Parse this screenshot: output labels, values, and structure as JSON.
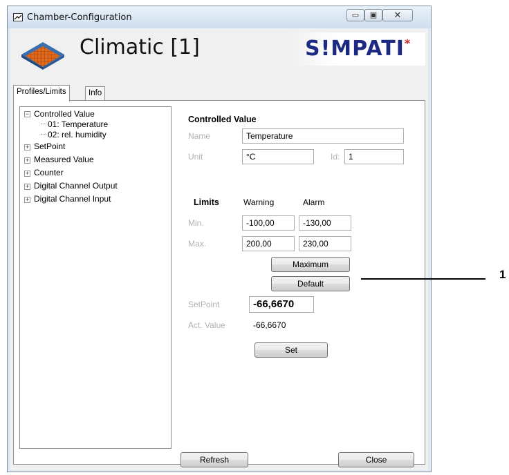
{
  "window": {
    "title": "Chamber-Configuration",
    "controls": {
      "minimize": "▭",
      "maximize": "▣",
      "close": "✕"
    }
  },
  "header": {
    "chamber_name": "Climatic [1]",
    "logo_text": "S!MPATI",
    "logo_star": "*"
  },
  "tabs": [
    {
      "label": "Profiles/Limits",
      "active": true
    },
    {
      "label": "Info",
      "active": false
    }
  ],
  "tree": {
    "items": [
      {
        "label": "Controlled Value",
        "expander": "−"
      },
      {
        "label": "01: Temperature"
      },
      {
        "label": "02: rel. humidity"
      },
      {
        "label": "SetPoint",
        "expander": "+"
      },
      {
        "label": "Measured Value",
        "expander": "+"
      },
      {
        "label": "Counter",
        "expander": "+"
      },
      {
        "label": "Digital Channel Output",
        "expander": "+"
      },
      {
        "label": "Digital Channel Input",
        "expander": "+"
      }
    ]
  },
  "controlled_value": {
    "heading": "Controlled Value",
    "name_label": "Name",
    "name_value": "Temperature",
    "unit_label": "Unit",
    "unit_value": "°C",
    "id_label": "Id:",
    "id_value": "1"
  },
  "limits": {
    "heading": "Limits",
    "warning_header": "Warning",
    "alarm_header": "Alarm",
    "min_label": "Min.",
    "max_label": "Max.",
    "min_warning": "-100,00",
    "min_alarm": "-130,00",
    "max_warning": "200,00",
    "max_alarm": "230,00",
    "maximum_button": "Maximum",
    "default_button": "Default"
  },
  "setpoint": {
    "label": "SetPoint",
    "value": "-66,6670",
    "act_label": "Act. Value",
    "act_value": "-66,6670",
    "set_button": "Set"
  },
  "footer": {
    "refresh_button": "Refresh",
    "close_button": "Close"
  },
  "callout": {
    "number": "1"
  },
  "colors": {
    "logo_blue": "#1d2a84",
    "logo_red": "#c8281e",
    "disabled_label": "#b2b2b2"
  }
}
